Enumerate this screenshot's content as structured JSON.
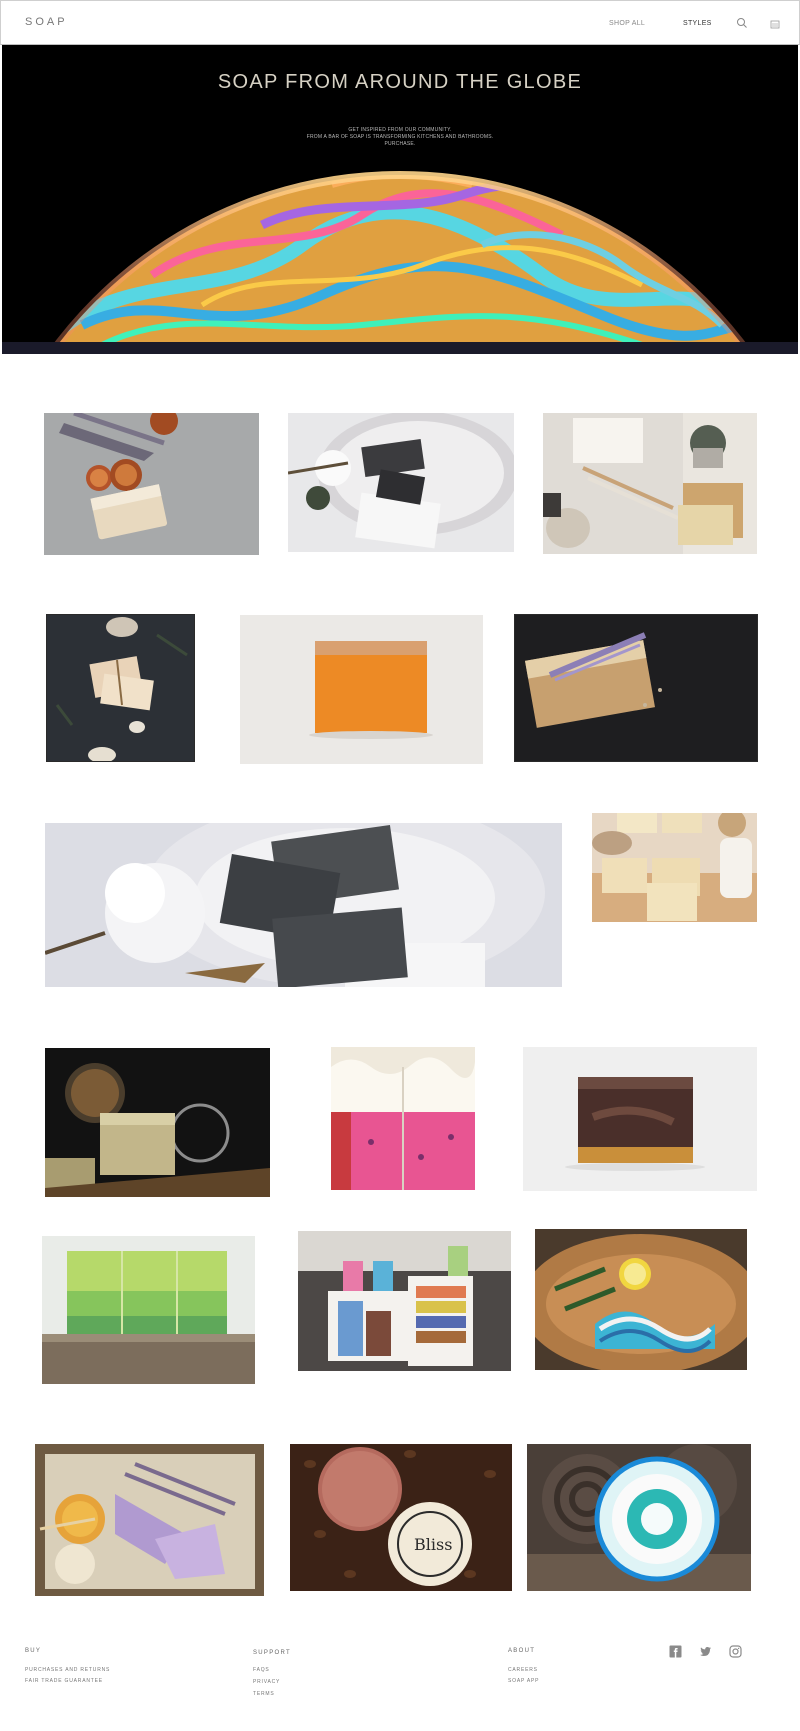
{
  "header": {
    "logo": "SOAP",
    "nav": {
      "shop_all": "SHOP ALL",
      "styles": "STYLES"
    }
  },
  "hero": {
    "title": "SOAP FROM AROUND THE GLOBE",
    "line1": "GET INSPIRED FROM OUR COMMUNITY.",
    "line2": "FROM A BAR OF SOAP IS TRANSFORMING KITCHENS AND BATHROOMS.",
    "line3": "PURCHASE.",
    "image": "soap-bubble-planet"
  },
  "gallery": [
    {
      "subject": "soap-with-lavender-and-orange-slices"
    },
    {
      "subject": "charcoal-soap-on-plate-with-flowers"
    },
    {
      "subject": "soap-set-with-towel-and-plant"
    },
    {
      "subject": "small-soap-bars-on-dark-table"
    },
    {
      "subject": "orange-soap-bar"
    },
    {
      "subject": "lavender-soap-on-slate"
    },
    {
      "subject": "charcoal-soap-with-magnolia"
    },
    {
      "subject": "oat-milk-soap-bars"
    },
    {
      "subject": "herbal-soap-with-seeds"
    },
    {
      "subject": "pink-and-white-layered-soap"
    },
    {
      "subject": "chocolate-soap-bar"
    },
    {
      "subject": "green-layered-soap"
    },
    {
      "subject": "colorful-soap-stacks-on-shelf"
    },
    {
      "subject": "blue-swirl-soap-with-lemon"
    },
    {
      "subject": "lavender-soap-with-honey"
    },
    {
      "subject": "coffee-soap-bars"
    },
    {
      "subject": "teal-and-white-round-soap"
    }
  ],
  "footer": {
    "buy": {
      "title": "BUY",
      "links": [
        "PURCHASES AND RETURNS",
        "FAIR TRADE GUARANTEE"
      ]
    },
    "support": {
      "title": "SUPPORT",
      "links": [
        "FAQS",
        "PRIVACY",
        "TERMS"
      ]
    },
    "about": {
      "title": "ABOUT",
      "links": [
        "CAREERS",
        "SOAP APP"
      ]
    },
    "social": [
      "facebook-icon",
      "twitter-icon",
      "instagram-icon"
    ]
  },
  "colors": {
    "hero_bg": "#000000",
    "hero_title": "#d6d1c4",
    "text_grey": "#777777"
  }
}
